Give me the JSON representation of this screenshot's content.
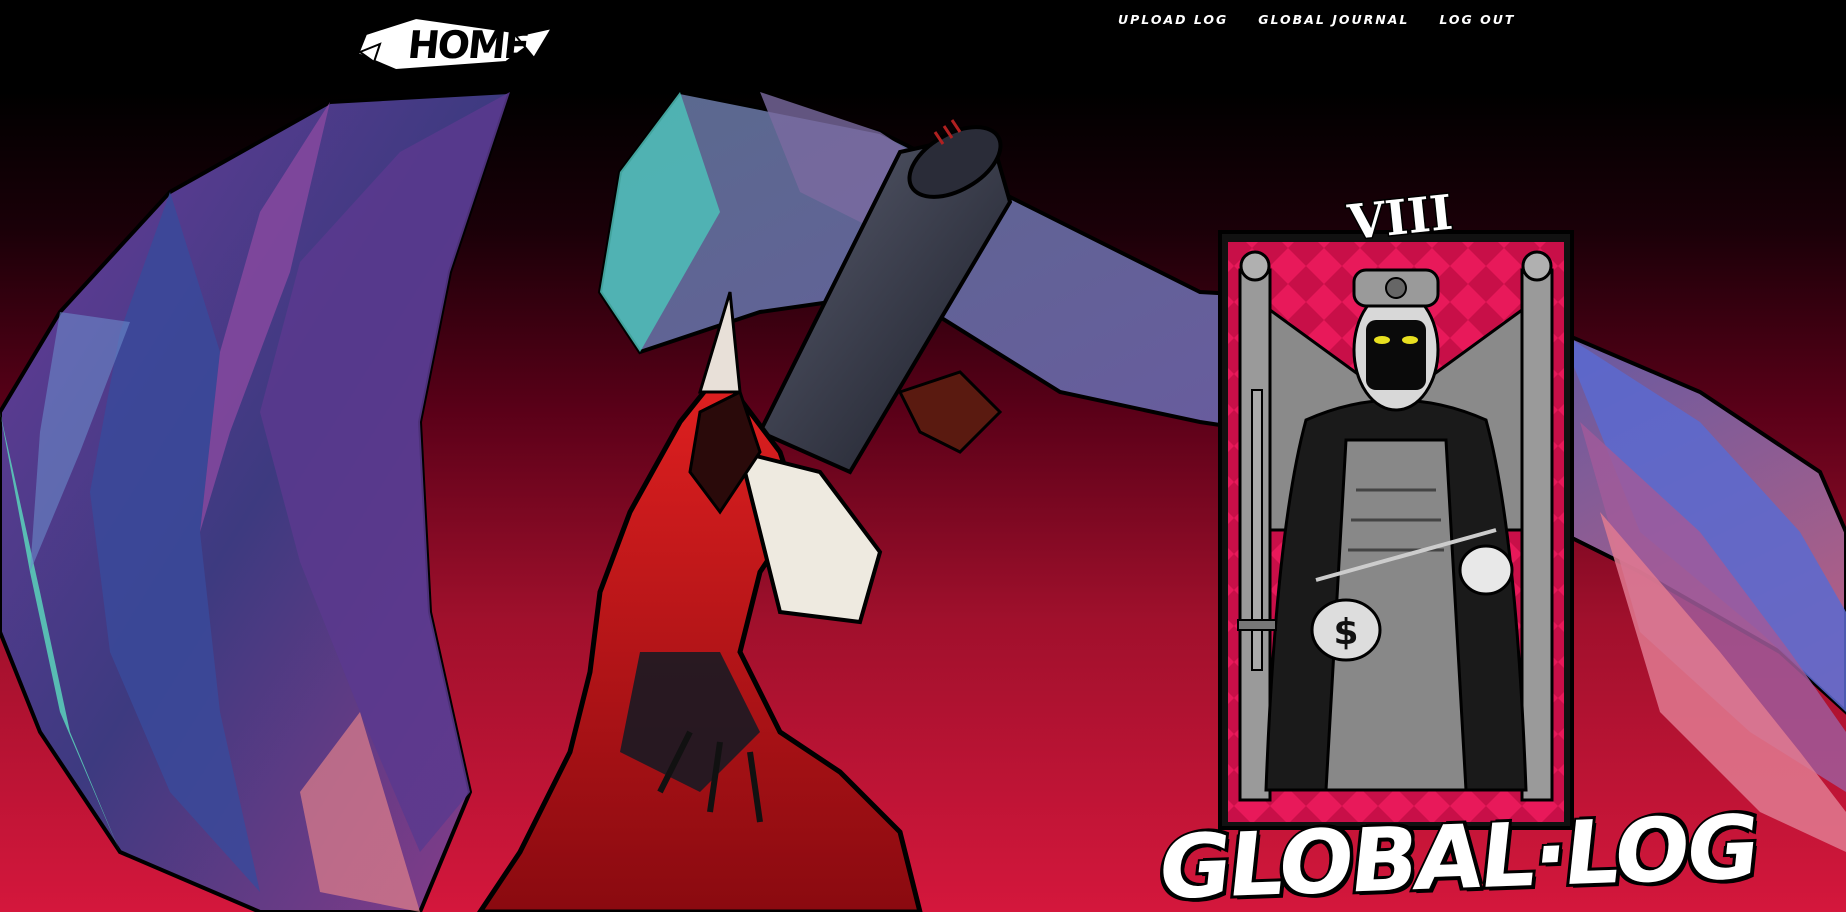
{
  "header": {
    "home_label": "HOME",
    "nav": [
      {
        "label": "UPLOAD LOG"
      },
      {
        "label": "GLOBAL JOURNAL"
      },
      {
        "label": "LOG OUT"
      }
    ]
  },
  "hero": {
    "title": "GLOBAL·LOG",
    "card_numeral": "VIII"
  },
  "colors": {
    "background_top": "#000000",
    "background_bottom": "#d4173c",
    "card_pink": "#e8195a",
    "nav_text": "#ffffff"
  }
}
